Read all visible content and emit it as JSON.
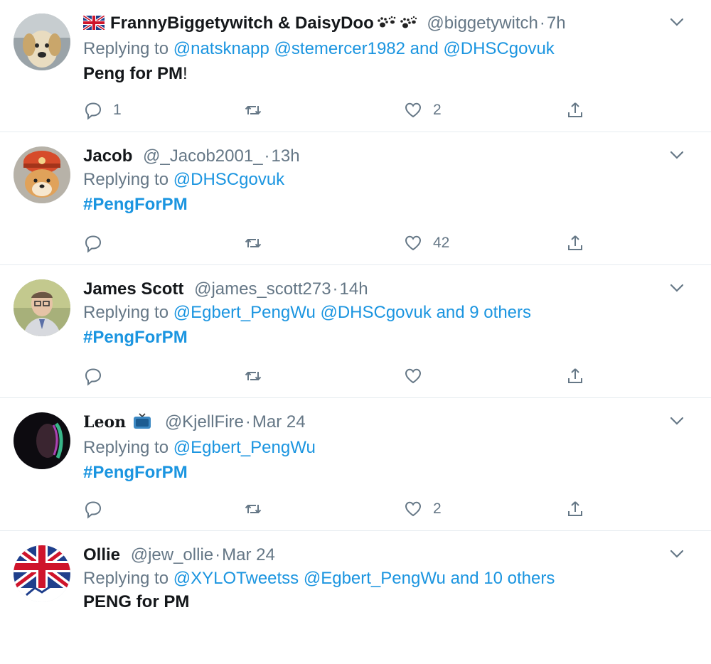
{
  "icons": {
    "reply": "reply-icon",
    "retweet": "retweet-icon",
    "like": "heart-icon",
    "share": "share-icon",
    "caret": "chevron-down-icon"
  },
  "colors": {
    "link": "#1b95e0",
    "secondary": "#657786",
    "text": "#14171a",
    "divider": "#e6ecf0"
  },
  "tweets": [
    {
      "name": "FrannyBiggetywitch & DaisyDoo",
      "handle": "@biggetywitch",
      "time": "7h",
      "replying_prefix": "Replying to",
      "replying_to": [
        "@natsknapp",
        "@stemercer1982"
      ],
      "replying_join": "and",
      "replying_last": "@DHSCgovuk",
      "text_bold": "Peng for PM",
      "text_plain": "!",
      "replies": "1",
      "retweets": "",
      "likes": "2"
    },
    {
      "name": "Jacob",
      "handle": "@_Jacob2001_",
      "time": "13h",
      "replying_prefix": "Replying to",
      "replying_last": "@DHSCgovuk",
      "hashtag": "#PengForPM",
      "replies": "",
      "retweets": "",
      "likes": "42"
    },
    {
      "name": "James Scott",
      "handle": "@james_scott273",
      "time": "14h",
      "replying_prefix": "Replying to",
      "replying_to": [
        "@Egbert_PengWu",
        "@DHSCgovuk"
      ],
      "replying_join": "and",
      "replying_last": "9 others",
      "hashtag": "#PengForPM",
      "replies": "",
      "retweets": "",
      "likes": ""
    },
    {
      "name": "Leon",
      "handle": "@KjellFire",
      "time": "Mar 24",
      "replying_prefix": "Replying to",
      "replying_last": "@Egbert_PengWu",
      "hashtag": "#PengForPM",
      "replies": "",
      "retweets": "",
      "likes": "2"
    },
    {
      "name": "Ollie",
      "handle": "@jew_ollie",
      "time": "Mar 24",
      "replying_prefix": "Replying to",
      "replying_to": [
        "@XYLOTweetss",
        "@Egbert_PengWu"
      ],
      "replying_join": "and",
      "replying_last": "10 others",
      "text_bold": "PENG for PM"
    }
  ]
}
